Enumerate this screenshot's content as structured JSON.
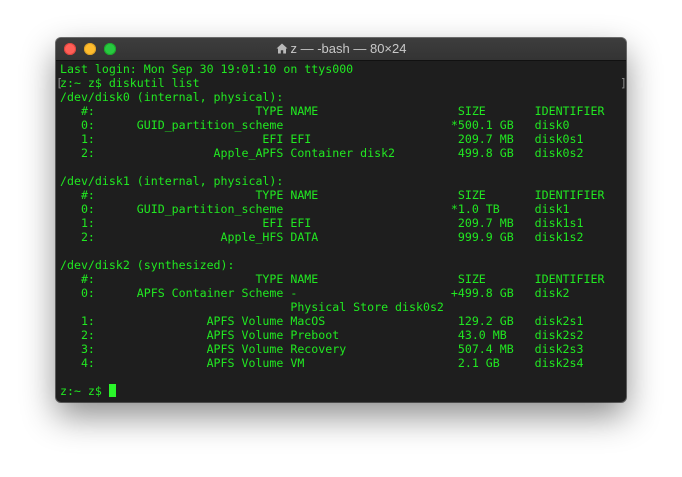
{
  "window": {
    "title": "z — -bash — 80×24",
    "title_icon": "home-icon"
  },
  "terminal": {
    "lines": [
      "Last login: Mon Sep 30 19:01:10 on ttys000",
      "z:~ z$ diskutil list",
      "/dev/disk0 (internal, physical):",
      "   #:                       TYPE NAME                    SIZE       IDENTIFIER",
      "   0:      GUID_partition_scheme                        *500.1 GB   disk0",
      "   1:                        EFI EFI                     209.7 MB   disk0s1",
      "   2:                 Apple_APFS Container disk2         499.8 GB   disk0s2",
      "",
      "/dev/disk1 (internal, physical):",
      "   #:                       TYPE NAME                    SIZE       IDENTIFIER",
      "   0:      GUID_partition_scheme                        *1.0 TB     disk1",
      "   1:                        EFI EFI                     209.7 MB   disk1s1",
      "   2:                  Apple_HFS DATA                    999.9 GB   disk1s2",
      "",
      "/dev/disk2 (synthesized):",
      "   #:                       TYPE NAME                    SIZE       IDENTIFIER",
      "   0:      APFS Container Scheme -                      +499.8 GB   disk2",
      "                                 Physical Store disk0s2",
      "   1:                APFS Volume MacOS                   129.2 GB   disk2s1",
      "   2:                APFS Volume Preboot                 43.0 MB    disk2s2",
      "   3:                APFS Volume Recovery                507.4 MB   disk2s3",
      "   4:                APFS Volume VM                      2.1 GB     disk2s4",
      "",
      "z:~ z$ "
    ]
  },
  "colors": {
    "text": "#21e821",
    "background": "#1e1e1e",
    "cursor": "#2af52a"
  }
}
